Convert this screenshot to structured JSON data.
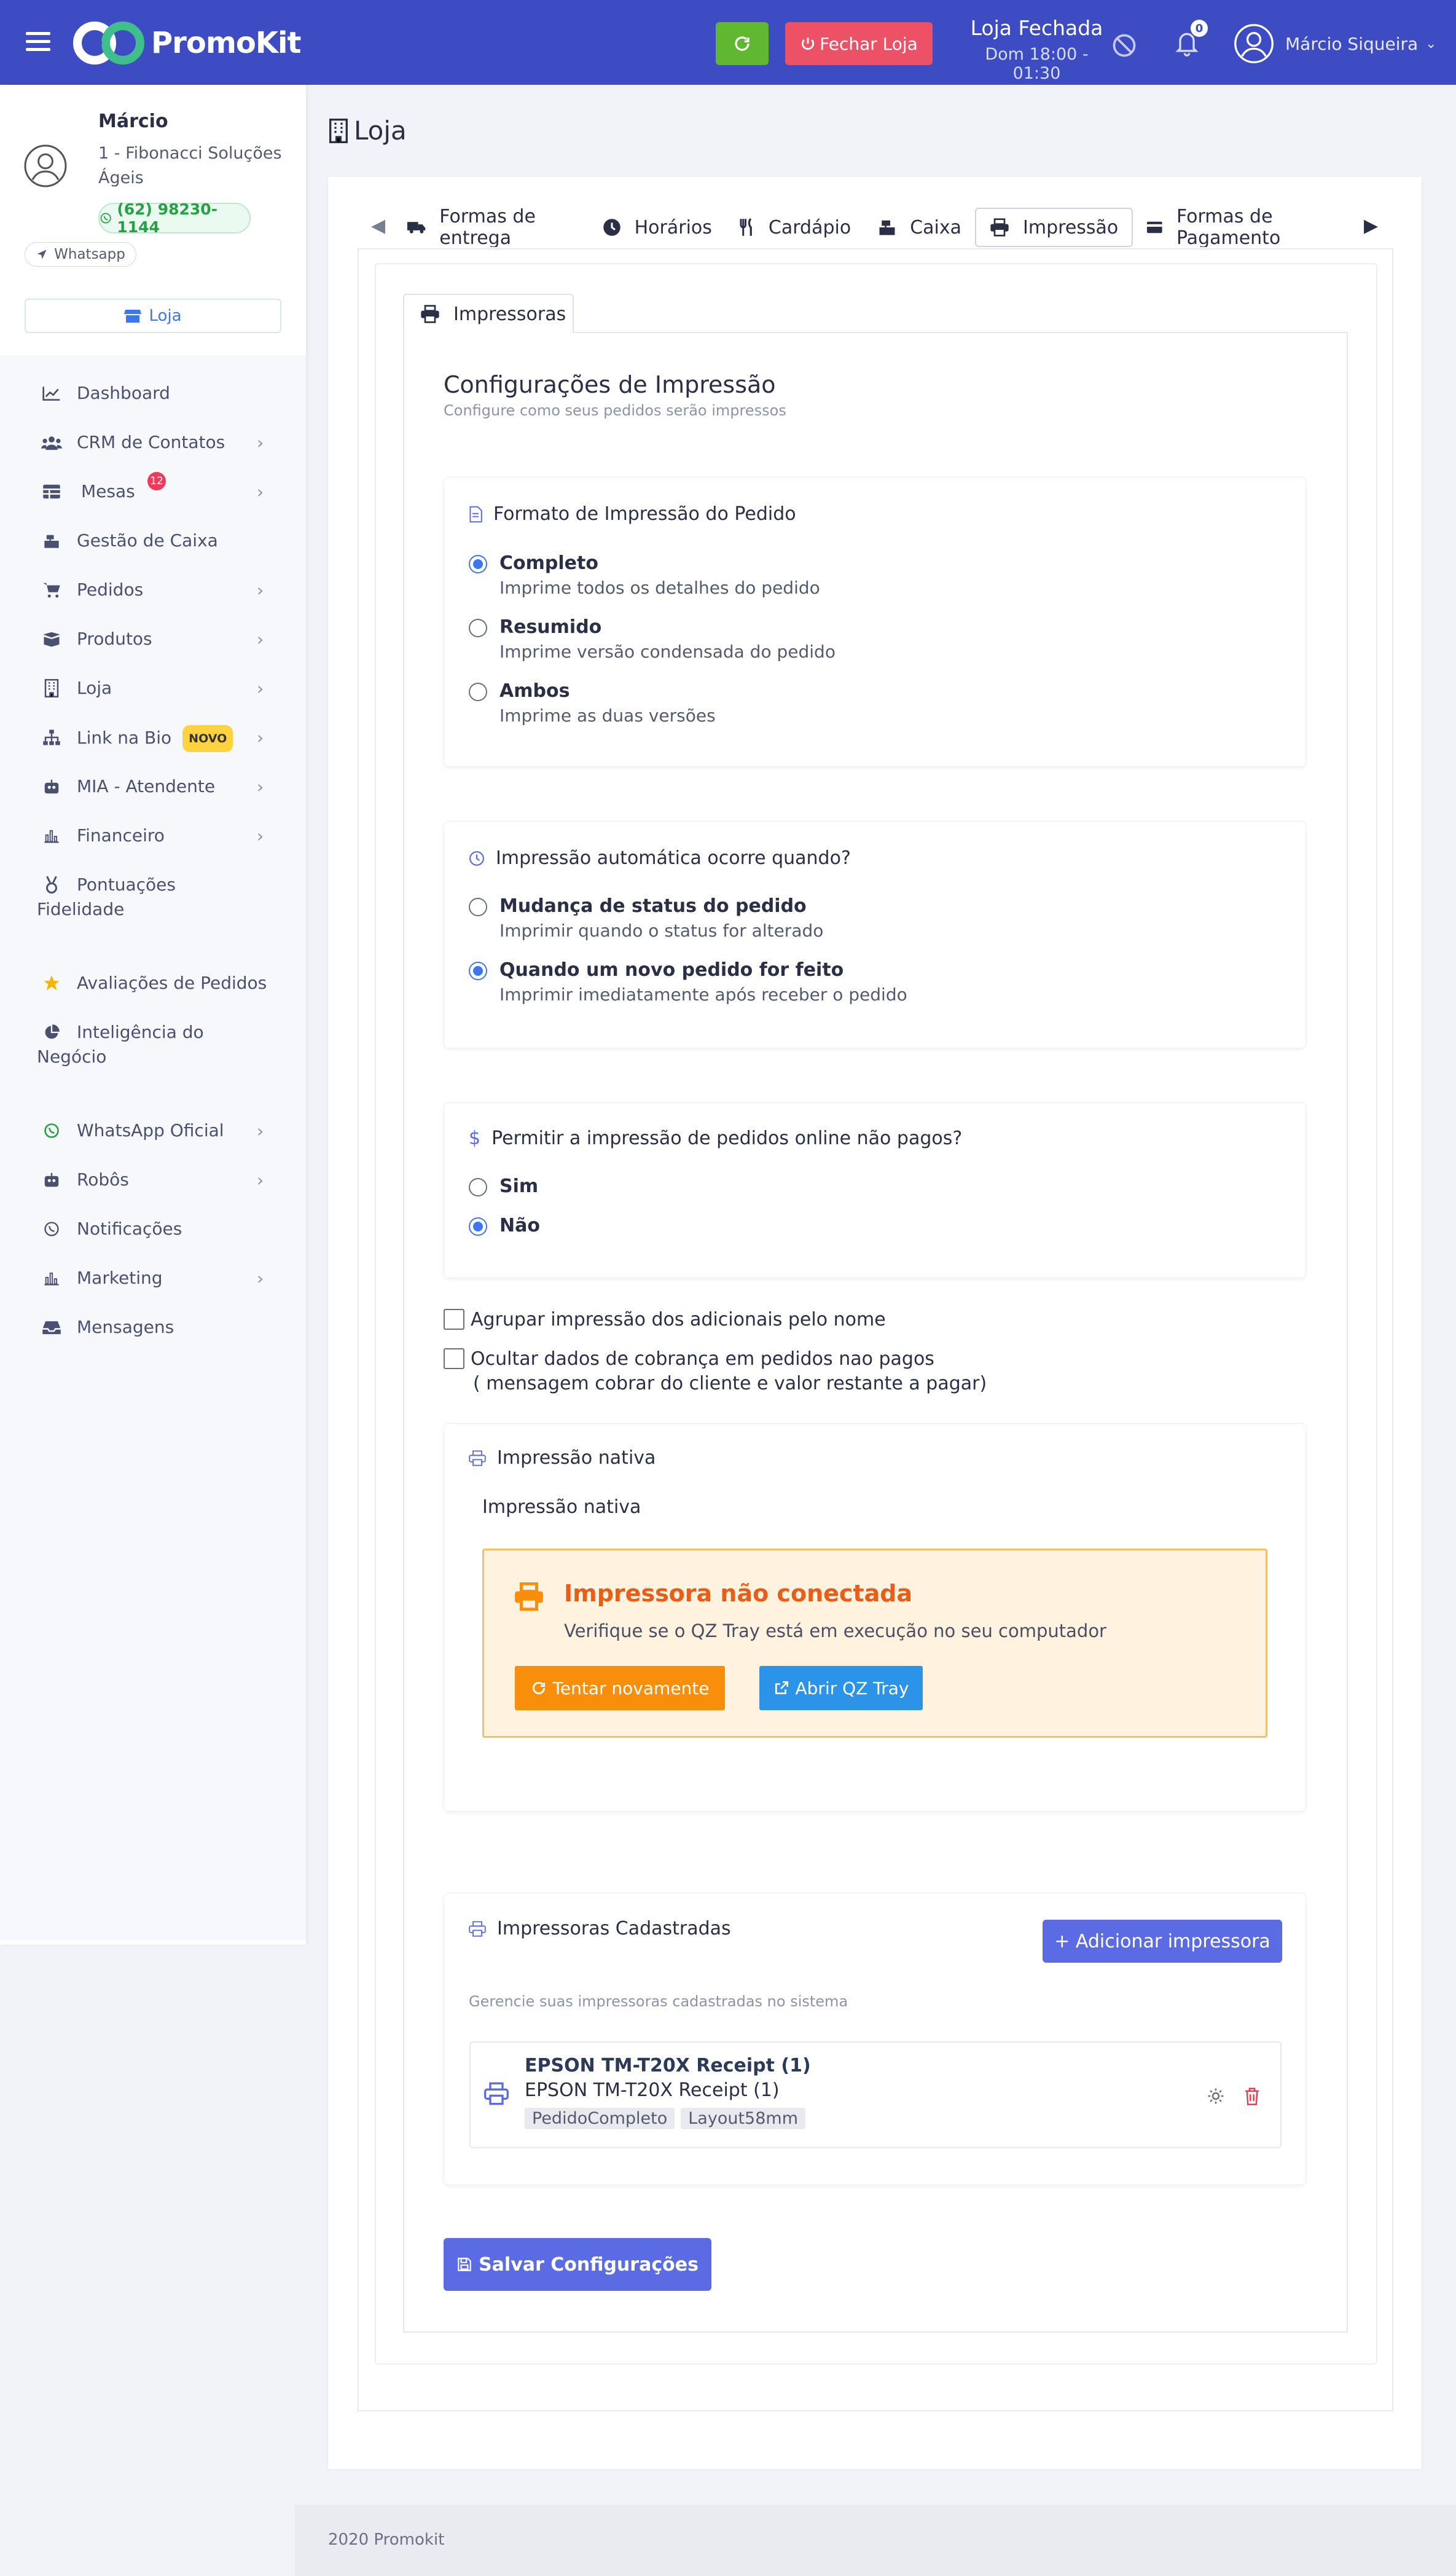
{
  "brand": {
    "name": "PromoKit"
  },
  "header": {
    "close_store_label": "Fechar Loja",
    "store_status": "Loja Fechada",
    "store_hours": "Dom 18:00 - 01:30",
    "notifications_count": "0",
    "user_name": "Márcio Siqueira"
  },
  "profile": {
    "name": "Márcio",
    "company": "1 - Fibonacci Soluções Ágeis",
    "phone": "(62) 98230-1144",
    "whatsapp_label": "Whatsapp",
    "store_button": "Loja"
  },
  "menu": [
    {
      "label": "Dashboard",
      "icon": "chart-line-icon"
    },
    {
      "label": "CRM de Contatos",
      "icon": "users-icon"
    },
    {
      "label": "Mesas",
      "icon": "table-icon",
      "badge": "12"
    },
    {
      "label": "Gestão de Caixa",
      "icon": "cash-register-icon"
    },
    {
      "label": "Pedidos",
      "icon": "cart-icon"
    },
    {
      "label": "Produtos",
      "icon": "box-icon"
    },
    {
      "label": "Loja",
      "icon": "building-icon"
    },
    {
      "label": "Link na Bio",
      "icon": "sitemap-icon",
      "tag": "NOVO"
    },
    {
      "label": "MIA - Atendente",
      "icon": "robot-icon"
    },
    {
      "label": "Financeiro",
      "icon": "bar-chart-icon"
    },
    {
      "label": "Pontuações Fidelidade",
      "icon": "medal-icon"
    },
    {
      "label": "Avaliações de Pedidos",
      "icon": "star-icon"
    },
    {
      "label": "Inteligência do Negócio",
      "icon": "pie-chart-icon"
    },
    {
      "label": "WhatsApp Oficial",
      "icon": "whatsapp-icon"
    },
    {
      "label": "Robôs",
      "icon": "robot-icon"
    },
    {
      "label": "Notificações",
      "icon": "whatsapp-icon"
    },
    {
      "label": "Marketing",
      "icon": "bar-chart-icon"
    },
    {
      "label": "Mensagens",
      "icon": "inbox-icon"
    }
  ],
  "page": {
    "title": "Loja"
  },
  "tabs": [
    "Formas de entrega",
    "Horários",
    "Cardápio",
    "Caixa",
    "Impressão",
    "Formas de Pagamento"
  ],
  "subtab": "Impressoras",
  "settings": {
    "title": "Configurações de Impressão",
    "subtitle": "Configure como seus pedidos serão impressos",
    "format": {
      "heading": "Formato de Impressão do Pedido",
      "options": [
        {
          "label": "Completo",
          "desc": "Imprime todos os detalhes do pedido",
          "selected": true
        },
        {
          "label": "Resumido",
          "desc": "Imprime versão condensada do pedido",
          "selected": false
        },
        {
          "label": "Ambos",
          "desc": "Imprime as duas versões",
          "selected": false
        }
      ]
    },
    "auto": {
      "heading": "Impressão automática ocorre quando?",
      "options": [
        {
          "label": "Mudança de status do pedido",
          "desc": "Imprimir quando o status for alterado",
          "selected": false
        },
        {
          "label": "Quando um novo pedido for feito",
          "desc": "Imprimir imediatamente após receber o pedido",
          "selected": true
        }
      ]
    },
    "unpaid": {
      "heading": "Permitir a impressão de pedidos online não pagos?",
      "options": [
        {
          "label": "Sim",
          "selected": false
        },
        {
          "label": "Não",
          "selected": true
        }
      ]
    },
    "checkbox_group": "Agrupar impressão dos adicionais pelo nome",
    "checkbox_hide_line1": "Ocultar dados de cobrança em pedidos nao pagos",
    "checkbox_hide_line2": "( mensagem cobrar do cliente e valor restante a pagar)",
    "native": {
      "heading": "Impressão nativa",
      "label": "Impressão nativa",
      "alert_title": "Impressora não conectada",
      "alert_text": "Verifique se o QZ Tray está em execução no seu computador",
      "retry_label": "Tentar novamente",
      "open_qz_label": "Abrir QZ Tray"
    },
    "registered": {
      "heading": "Impressoras Cadastradas",
      "add_label": "+ Adicionar impressora",
      "desc": "Gerencie suas impressoras cadastradas no sistema",
      "printers": [
        {
          "title": "EPSON TM-T20X Receipt (1)",
          "name": "EPSON TM-T20X Receipt (1)",
          "tags": [
            "PedidoCompleto",
            "Layout58mm"
          ]
        }
      ]
    },
    "save_label": "Salvar Configurações"
  },
  "footer": {
    "text": "2020 Promokit"
  },
  "colors": {
    "primary": "#3d4cc2",
    "accent": "#5b6be3",
    "danger": "#ec5166",
    "success": "#5fb830",
    "warning": "#f98e0a"
  }
}
